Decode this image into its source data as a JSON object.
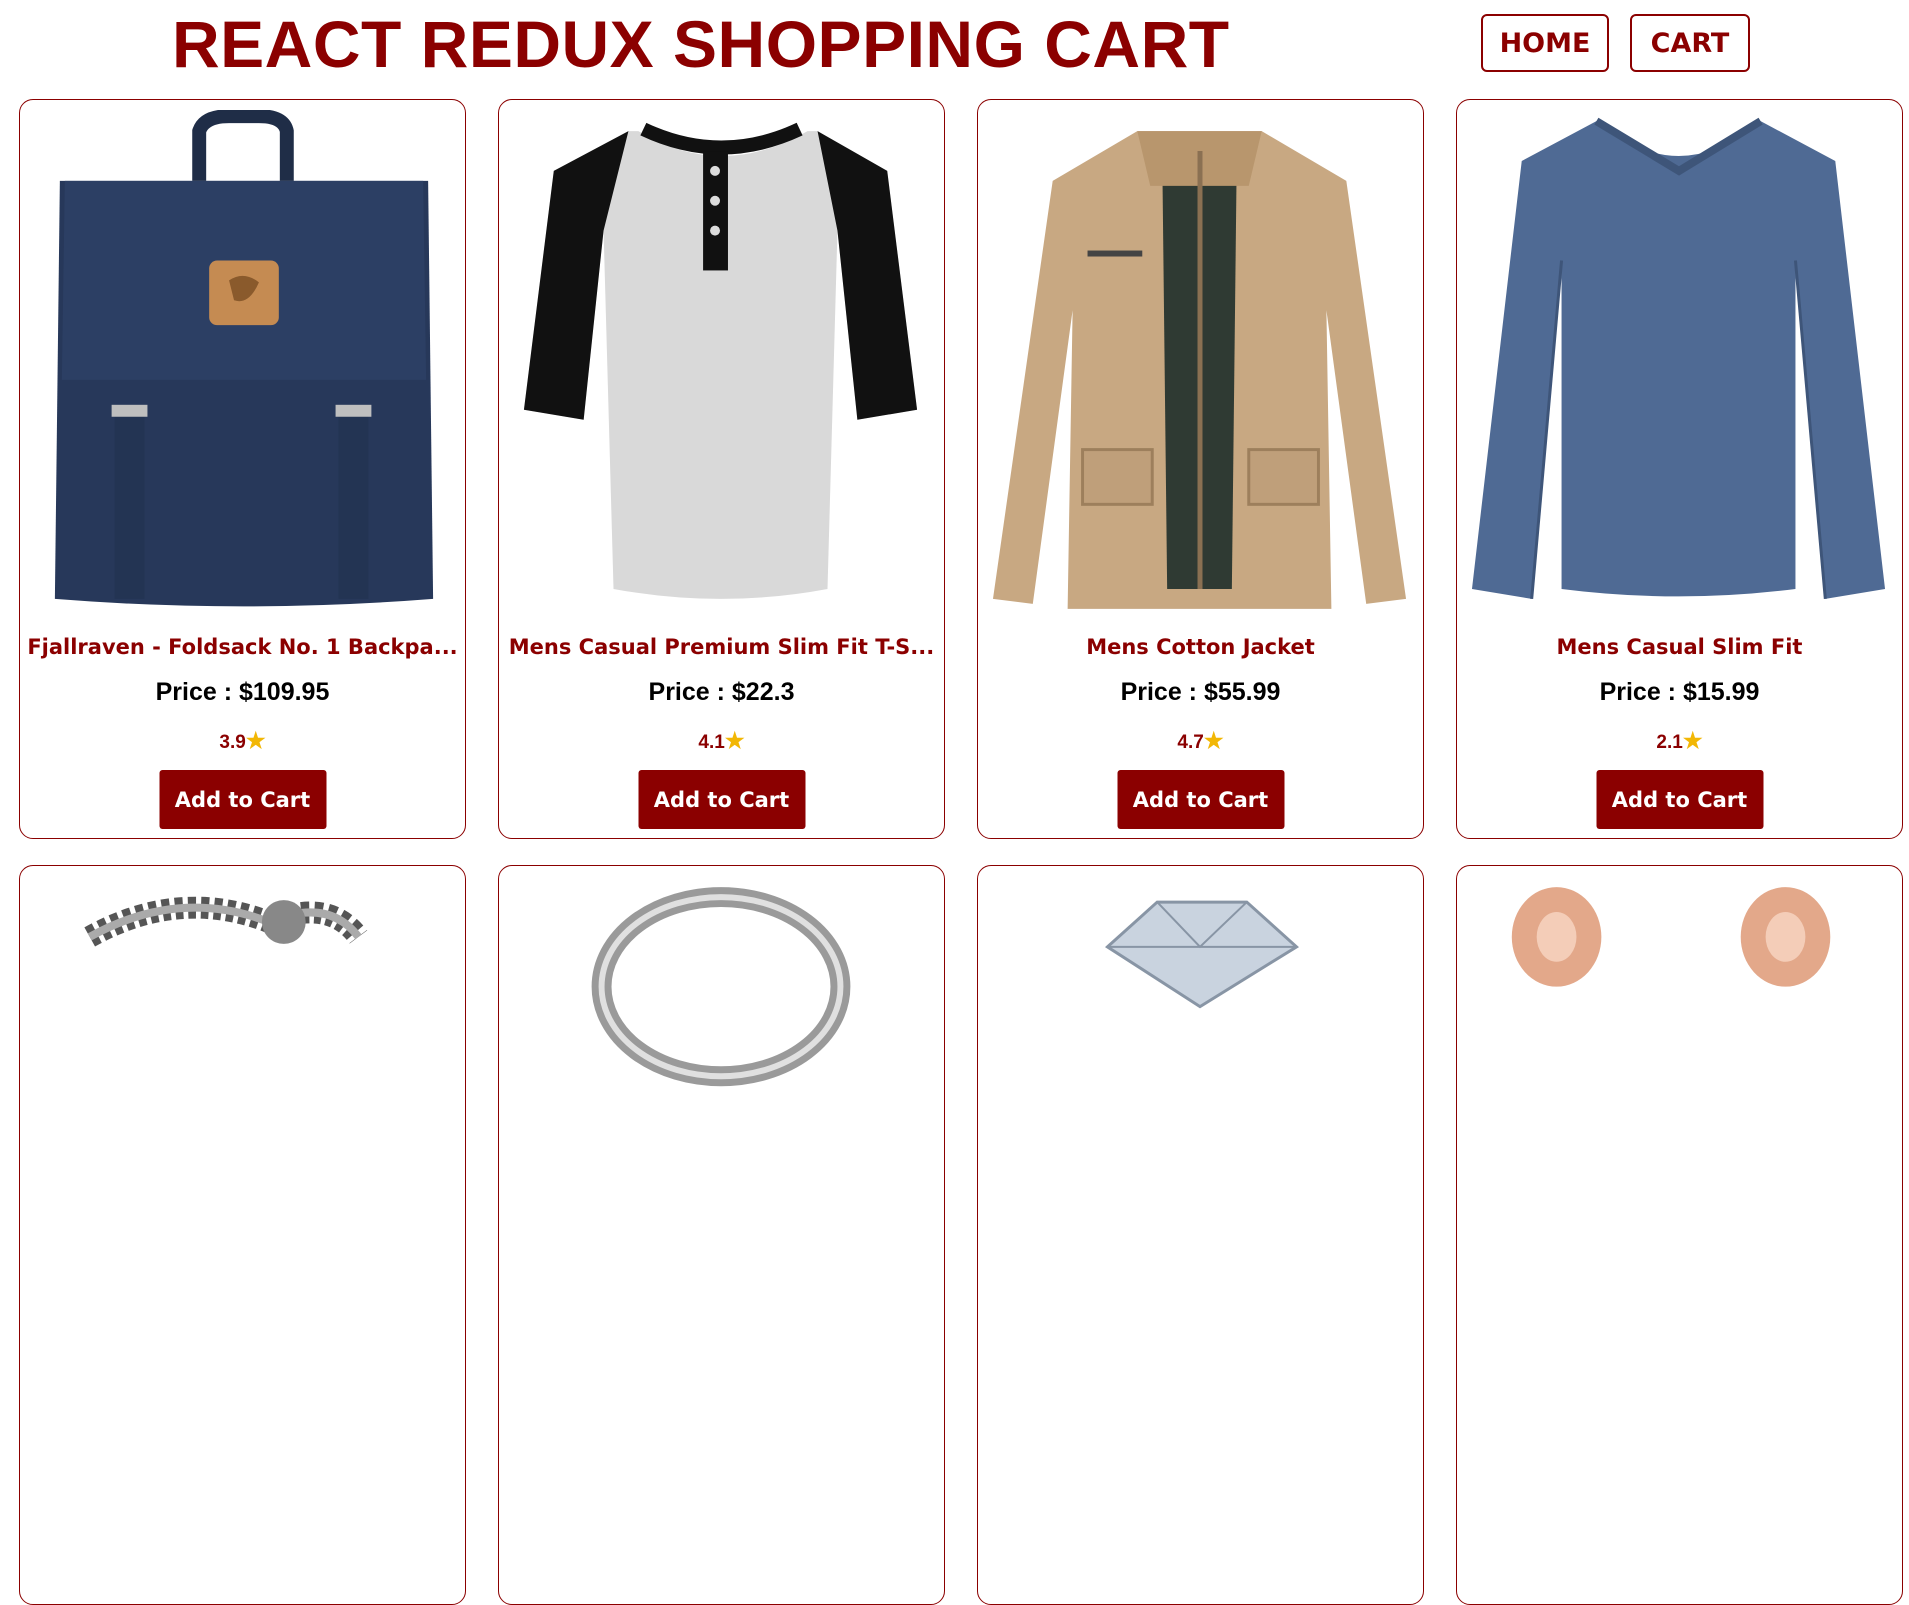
{
  "header": {
    "title": "REACT REDUX SHOPPING CART",
    "nav": {
      "home": "HOME",
      "cart": "CART"
    }
  },
  "products": [
    {
      "title": "Fjallraven - Foldsack No. 1 Backpa...",
      "price_label": "Price : ",
      "price": "$109.95",
      "rating": "3.9",
      "button": "Add to Cart",
      "image_icon": "backpack-image"
    },
    {
      "title": "Mens Casual Premium Slim Fit T-S...",
      "price_label": "Price : ",
      "price": "$22.3",
      "rating": "4.1",
      "button": "Add to Cart",
      "image_icon": "raglan-tshirt-image"
    },
    {
      "title": "Mens Cotton Jacket",
      "price_label": "Price : ",
      "price": "$55.99",
      "rating": "4.7",
      "button": "Add to Cart",
      "image_icon": "cotton-jacket-image"
    },
    {
      "title": "Mens Casual Slim Fit",
      "price_label": "Price : ",
      "price": "$15.99",
      "rating": "2.1",
      "button": "Add to Cart",
      "image_icon": "longsleeve-shirt-image"
    },
    {
      "image_icon": "chain-bracelet-image"
    },
    {
      "image_icon": "silver-ring-image"
    },
    {
      "image_icon": "diamond-ring-image"
    },
    {
      "image_icon": "rose-gold-earrings-image"
    }
  ],
  "colors": {
    "accent": "#8b0000",
    "star": "#f2b705",
    "text": "#000000"
  }
}
